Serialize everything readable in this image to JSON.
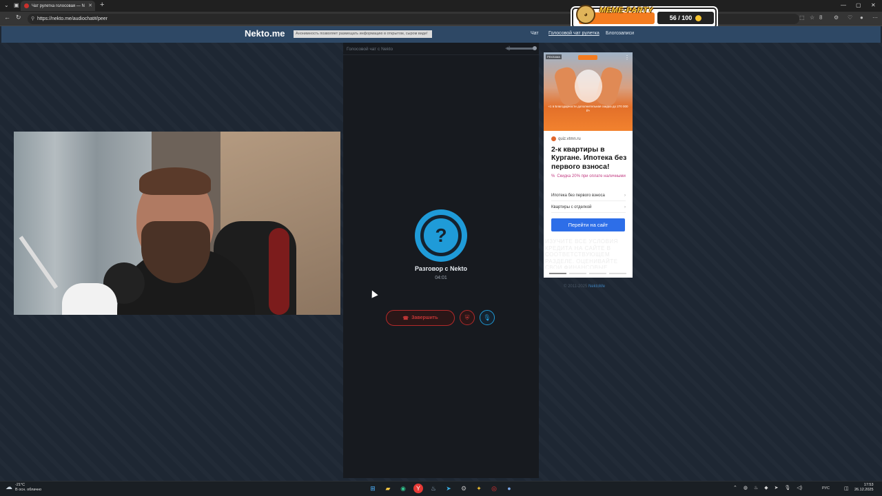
{
  "browser": {
    "tab_title": "Чат рулетка голосовая — N",
    "url": "https://nekto.me/audiochat#/peer",
    "ext_badge": "8"
  },
  "overlay": {
    "title": "MEME-PARTY",
    "counter": "56 / 100"
  },
  "site": {
    "logo": "Nekto.me",
    "notice": "Анонимность позволяет размещать информацию в открытом, сыром виде!",
    "nav": [
      "Чат",
      "Голосовой чат рулетка",
      "Блогозаписи"
    ],
    "active_nav": "Голосовой чат рулетка"
  },
  "chat": {
    "header": "Голосовой чат с Nekto",
    "avatar_symbol": "?",
    "title": "Разговор с Nekto",
    "timer": "04:01",
    "end_label": "Завершить",
    "volume_level": 1.0
  },
  "ad": {
    "tag": "РЕКЛАМА",
    "promo": "«1 в Благодарности дополнительная скидка до 270 000 ₽»",
    "domain": "quiz.vtmn.ru",
    "headline": "2-к квартиры в Кургане. Ипотека без первого взноса!",
    "discount": "Скидка 20% при оплате наличными",
    "links": [
      "Ипотека без первого взноса",
      "Квартиры с отделкой"
    ],
    "cta": "Перейти на сайт",
    "disclaimer": "ИЗУЧИТЕ ВСЕ УСЛОВИЯ КРЕДИТА НА САЙТЕ В СООТВЕТСТВУЮЩЕМ РАЗДЕЛЕ. ОЦЕНИВАЙТЕ СВОИ ФИНАНСОВЫЕ ВОЗМОЖНОСТИ И РИСКИ"
  },
  "footer": {
    "copyright": "© 2011-2025",
    "link": "NektoMe"
  },
  "taskbar": {
    "temp": "-21°C",
    "weather": "В осн. облачно",
    "lang": "РУС",
    "time": "17:53",
    "date": "26.12.2025"
  },
  "colors": {
    "accent": "#1f9bd8",
    "danger": "#b52a2a",
    "header": "#2e4865",
    "cta": "#2d6ee8"
  }
}
